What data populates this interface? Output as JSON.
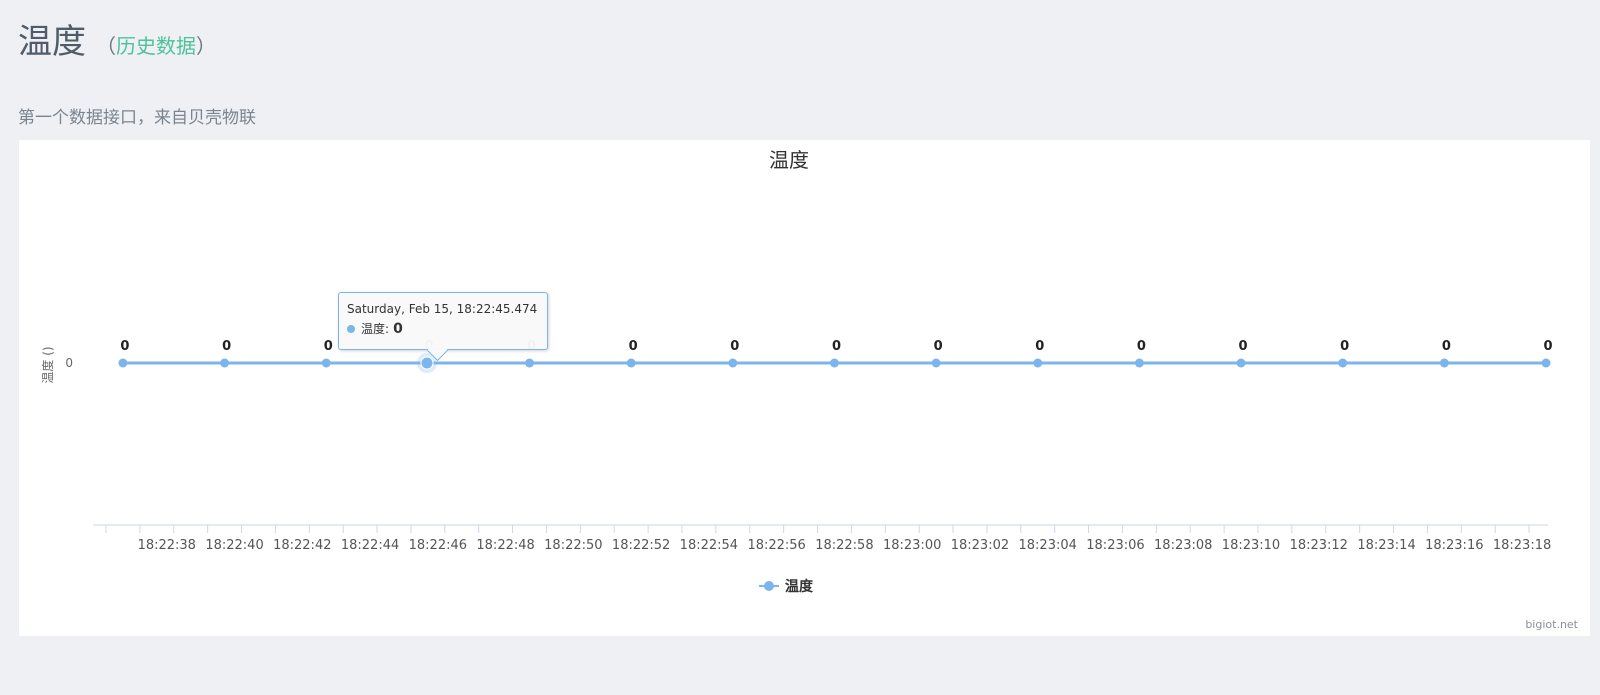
{
  "header": {
    "title": "温度",
    "open_paren": "（",
    "history_link": "历史数据",
    "close_paren": "）"
  },
  "subtitle": "第一个数据接口，来自贝壳物联",
  "credit": "bigiot.net",
  "colors": {
    "series": "#7cb5ec",
    "axis": "#ccd6eb",
    "link": "#4ec29a"
  },
  "tooltip": {
    "header": "Saturday, Feb 15, 18:22:45.474",
    "series_name": "温度",
    "separator": ":",
    "value": "0"
  },
  "chart_data": {
    "type": "line",
    "title": "温度",
    "ylabel": "温度 ()",
    "y_ticks": [
      "0"
    ],
    "x_tick_labels": [
      "18:22:38",
      "18:22:40",
      "18:22:42",
      "18:22:44",
      "18:22:46",
      "18:22:48",
      "18:22:50",
      "18:22:52",
      "18:22:54",
      "18:22:56",
      "18:22:58",
      "18:23:00",
      "18:23:02",
      "18:23:04",
      "18:23:06",
      "18:23:08",
      "18:23:10",
      "18:23:12",
      "18:23:14",
      "18:23:16",
      "18:23:18"
    ],
    "x_range": [
      "18:22:36.000",
      "18:23:18.500"
    ],
    "x": [
      "18:22:36.500",
      "18:22:39.500",
      "18:22:42.500",
      "18:22:45.474",
      "18:22:48.500",
      "18:22:51.500",
      "18:22:54.500",
      "18:22:57.500",
      "18:23:00.500",
      "18:23:03.500",
      "18:23:06.500",
      "18:23:09.500",
      "18:23:12.500",
      "18:23:15.500",
      "18:23:18.500"
    ],
    "highlighted_index": 3,
    "series": [
      {
        "name": "温度",
        "values": [
          0,
          0,
          0,
          0,
          0,
          0,
          0,
          0,
          0,
          0,
          0,
          0,
          0,
          0,
          0
        ],
        "data_labels": [
          "0",
          "0",
          "0",
          "0",
          "0",
          "0",
          "0",
          "0",
          "0",
          "0",
          "0",
          "0",
          "0",
          "0",
          "0"
        ]
      }
    ],
    "legend": {
      "position": "bottom-center",
      "label": "温度"
    }
  }
}
